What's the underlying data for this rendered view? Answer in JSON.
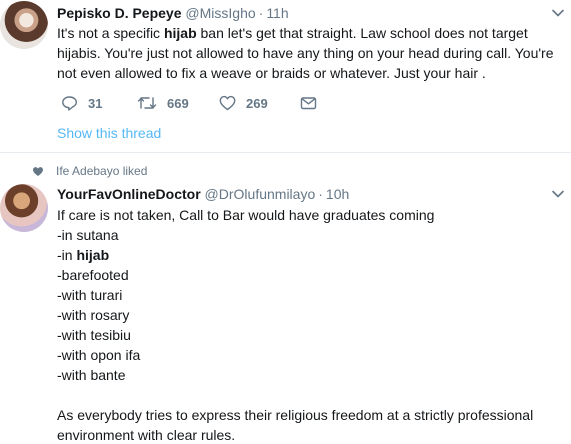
{
  "tweet1": {
    "name": "Pepisko D. Pepeye",
    "handle": "@MissIgho",
    "dot": "·",
    "time": "11h",
    "line1_pre": "It's not a specific ",
    "line1_bold": "hijab",
    "line1_post": " ban let's get that straight. Law school does not target",
    "line2": "hijabis. You're just not allowed to have any thing on your head during call. You're",
    "line3": "not even allowed to fix a weave or braids or whatever. Just your hair .",
    "reply_count": "31",
    "retweet_count": "669",
    "like_count": "269",
    "show_thread": "Show this thread"
  },
  "liked_by": "Ife Adebayo liked",
  "tweet2": {
    "name": "YourFavOnlineDoctor",
    "handle": "@DrOlufunmilayo",
    "dot": "·",
    "time": "10h",
    "l1": "If care is not taken, Call to Bar would have graduates coming",
    "l2": "-in sutana",
    "l3_pre": "-in ",
    "l3_bold": "hijab",
    "l4": "-barefooted",
    "l5": "-with turari",
    "l6": "-with rosary",
    "l7": "-with tesibiu",
    "l8": "-with opon ifa",
    "l9": "-with bante",
    "p2_l1": "As everybody tries to express their religious freedom at a strictly professional",
    "p2_l2": "environment with clear rules."
  },
  "colors": {
    "text": "#14171a",
    "secondary": "#657786",
    "link": "#1da1f2",
    "border": "#e6ecf0"
  },
  "icons": [
    "reply-icon",
    "retweet-icon",
    "like-icon",
    "direct-message-icon",
    "chevron-down-icon",
    "heart-filled-icon"
  ]
}
